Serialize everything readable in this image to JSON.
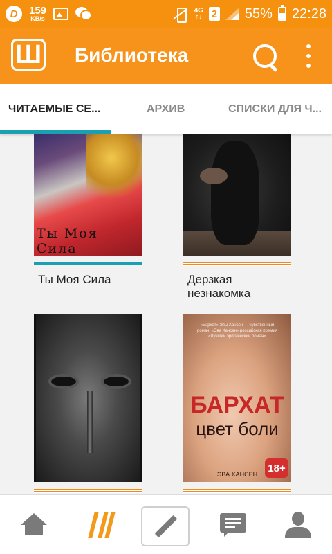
{
  "status_bar": {
    "net_speed": "159",
    "net_speed_unit": "KB/s",
    "network_type": "4G",
    "network_sub": "↑↓",
    "sim_slot": "2",
    "battery": "55%",
    "time": "22:28",
    "icons": [
      "d-app-icon",
      "image-icon",
      "wechat-icon",
      "vibrate-icon",
      "signal-icon",
      "battery-charging-icon"
    ]
  },
  "appbar": {
    "logo_glyph": "Ш",
    "title": "Библиотека",
    "icons": [
      "search-icon",
      "more-vert-icon"
    ]
  },
  "tabs": [
    {
      "label": "ЧИТАЕМЫЕ СЕ...",
      "active": true
    },
    {
      "label": "АРХИВ",
      "active": false
    },
    {
      "label": "СПИСКИ ДЛЯ Ч...",
      "active": false
    }
  ],
  "colors": {
    "primary": "#f7921a",
    "status_bar": "#f5910f",
    "tab_indicator": "#1aa0b0",
    "progress_orange": "#f08a1c"
  },
  "books": [
    {
      "title": "Ты Моя Сила",
      "cover_text": "Ты Моя Сила",
      "bar": "teal"
    },
    {
      "title": "Дерзкая незнакомка",
      "bar": "orange"
    },
    {
      "title": "",
      "bar": "orange"
    },
    {
      "title": "",
      "cover_title": "БАРХАТ",
      "cover_subtitle": "цвет боли",
      "cover_age": "18+",
      "cover_author": "ЭВА ХАНСЕН",
      "cover_blurb": "«Бархат» Эвы Хансен — чувственный роман. «Эва Хансен» российская премия «Лучший эротический роман»",
      "bar": "orange"
    }
  ],
  "bottom_nav": [
    {
      "name": "home",
      "icon": "home-icon"
    },
    {
      "name": "library",
      "icon": "library-icon"
    },
    {
      "name": "write",
      "icon": "pencil-icon"
    },
    {
      "name": "messages",
      "icon": "message-icon"
    },
    {
      "name": "profile",
      "icon": "profile-icon"
    }
  ]
}
